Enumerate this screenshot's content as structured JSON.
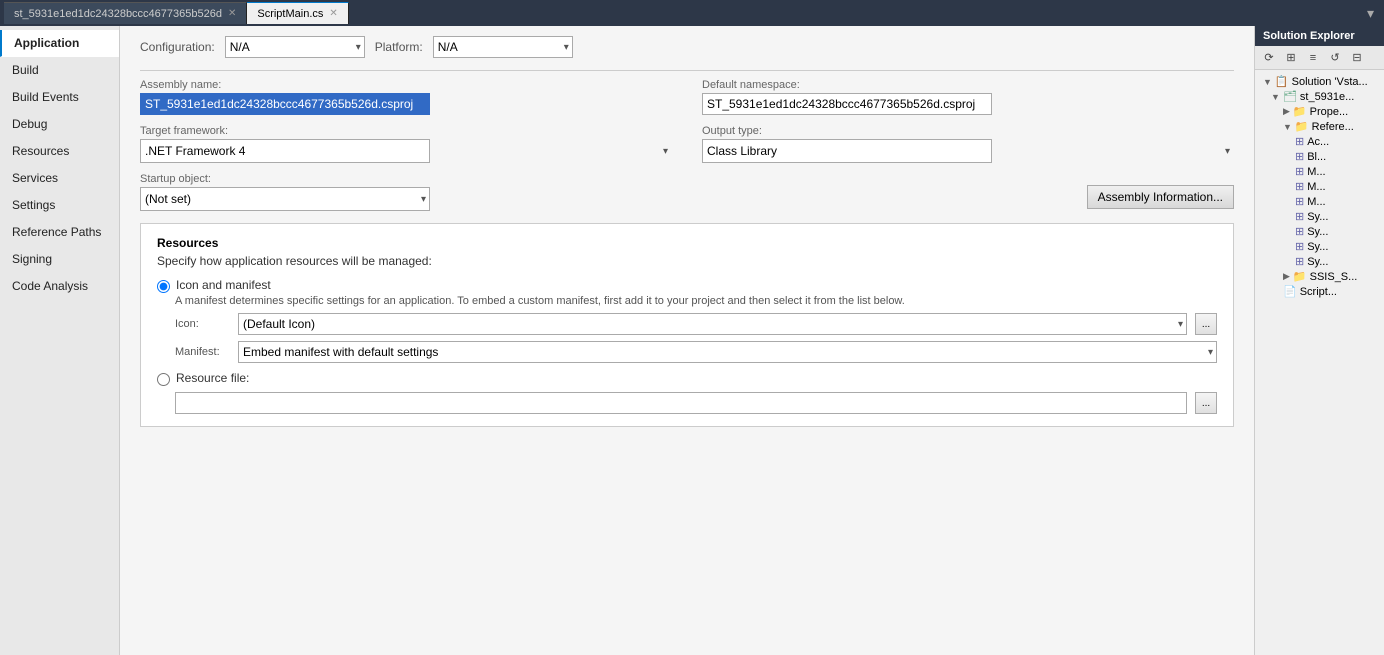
{
  "tabs": [
    {
      "id": "project-props",
      "label": "st_5931e1ed1dc24328bccc4677365b526d",
      "active": false
    },
    {
      "id": "script-main",
      "label": "ScriptMain.cs",
      "active": true
    }
  ],
  "tab_arrow": "▾",
  "left_nav": {
    "items": [
      {
        "id": "application",
        "label": "Application",
        "active": true
      },
      {
        "id": "build",
        "label": "Build",
        "active": false
      },
      {
        "id": "build-events",
        "label": "Build Events",
        "active": false
      },
      {
        "id": "debug",
        "label": "Debug",
        "active": false
      },
      {
        "id": "resources",
        "label": "Resources",
        "active": false
      },
      {
        "id": "services",
        "label": "Services",
        "active": false
      },
      {
        "id": "settings",
        "label": "Settings",
        "active": false
      },
      {
        "id": "reference-paths",
        "label": "Reference Paths",
        "active": false
      },
      {
        "id": "signing",
        "label": "Signing",
        "active": false
      },
      {
        "id": "code-analysis",
        "label": "Code Analysis",
        "active": false
      }
    ]
  },
  "config": {
    "configuration_label": "Configuration:",
    "configuration_value": "N/A",
    "platform_label": "Platform:",
    "platform_value": "N/A"
  },
  "assembly": {
    "name_label": "Assembly name:",
    "name_value": "ST_5931e1ed1dc24328bccc4677365b526d.csproj",
    "namespace_label": "Default namespace:",
    "namespace_value": "ST_5931e1ed1dc24328bccc4677365b526d.csproj",
    "framework_label": "Target framework:",
    "framework_value": ".NET Framework 4",
    "output_label": "Output type:",
    "output_value": "Class Library",
    "startup_label": "Startup object:",
    "startup_value": "(Not set)",
    "assembly_info_btn": "Assembly Information..."
  },
  "resources_section": {
    "title": "Resources",
    "subtitle": "Specify how application resources will be managed:",
    "icon_manifest_label": "Icon and manifest",
    "icon_manifest_desc": "A manifest determines specific settings for an application. To embed a custom manifest, first add it to your project and then select it from the list below.",
    "icon_label": "Icon:",
    "icon_value": "(Default Icon)",
    "icon_browse": "...",
    "manifest_label": "Manifest:",
    "manifest_value": "Embed manifest with default settings",
    "resource_file_label": "Resource file:",
    "resource_file_value": "",
    "resource_file_browse": "..."
  },
  "solution_explorer": {
    "title": "Solution Explorer",
    "toolbar_icons": [
      "sync",
      "properties",
      "show-all",
      "refresh",
      "collapse"
    ],
    "tree": [
      {
        "level": 0,
        "label": "Solution 'Vsta...",
        "icon": "solution",
        "expanded": true
      },
      {
        "level": 1,
        "label": "st_5931e...",
        "icon": "project",
        "expanded": true
      },
      {
        "level": 2,
        "label": "Prope...",
        "icon": "folder",
        "expanded": false
      },
      {
        "level": 2,
        "label": "Refere...",
        "icon": "folder",
        "expanded": true
      },
      {
        "level": 3,
        "label": "Ac...",
        "icon": "ref"
      },
      {
        "level": 3,
        "label": "Bl...",
        "icon": "ref"
      },
      {
        "level": 3,
        "label": "M...",
        "icon": "ref"
      },
      {
        "level": 3,
        "label": "M...",
        "icon": "ref"
      },
      {
        "level": 3,
        "label": "M...",
        "icon": "ref"
      },
      {
        "level": 3,
        "label": "Sy...",
        "icon": "ref"
      },
      {
        "level": 3,
        "label": "Sy...",
        "icon": "ref"
      },
      {
        "level": 3,
        "label": "Sy...",
        "icon": "ref"
      },
      {
        "level": 3,
        "label": "Sy...",
        "icon": "ref"
      },
      {
        "level": 2,
        "label": "SSIS_S...",
        "icon": "folder"
      },
      {
        "level": 2,
        "label": "Script...",
        "icon": "cs-file"
      }
    ]
  }
}
